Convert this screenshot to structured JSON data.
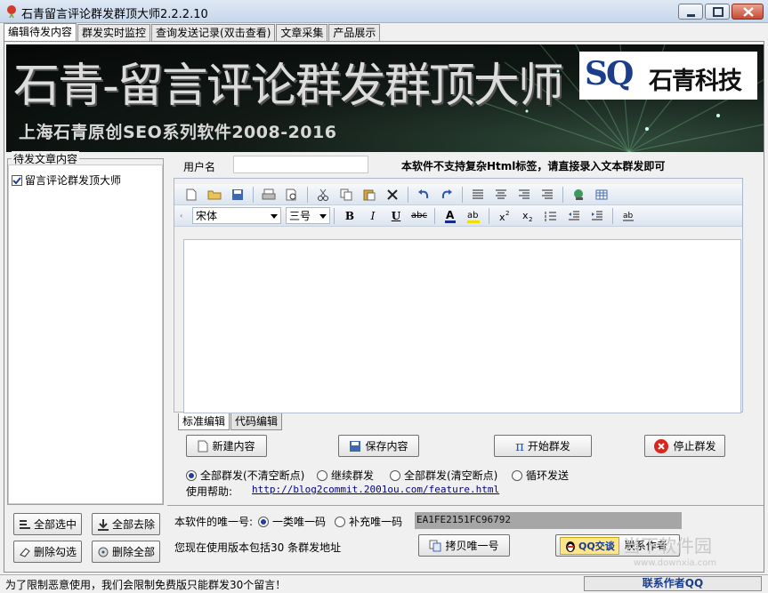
{
  "window": {
    "title": "石青留言评论群发群顶大师2.2.2.10",
    "minimize_icon": "minimize-icon",
    "maximize_icon": "maximize-icon",
    "close_icon": "close-icon"
  },
  "tabs": [
    {
      "label": "编辑待发内容",
      "active": true
    },
    {
      "label": "群发实时监控",
      "active": false
    },
    {
      "label": "查询发送记录(双击查看)",
      "active": false
    },
    {
      "label": "文章采集",
      "active": false
    },
    {
      "label": "产品展示",
      "active": false
    }
  ],
  "banner": {
    "title": "石青-留言评论群发群顶大师",
    "subtitle": "上海石青原创SEO系列软件2008-2016",
    "logo_sq": "SQ",
    "logo_text": "石青科技"
  },
  "left_panel": {
    "legend": "待发文章内容",
    "items": [
      {
        "label": "留言评论群发顶大师",
        "checked": true
      }
    ],
    "buttons": {
      "select_all": "全部选中",
      "deselect_all": "全部去除",
      "delete_checked": "删除勾选",
      "delete_all": "删除全部"
    }
  },
  "form": {
    "username_label": "用户名",
    "username_value": "",
    "html_notice": "本软件不支持复杂Html标签，请直接录入文本群发即可"
  },
  "editor": {
    "font": "宋体",
    "size": "三号",
    "tab_standard": "标准编辑",
    "tab_code": "代码编辑",
    "content": ""
  },
  "actions": {
    "new_content": "新建内容",
    "save_content": "保存内容",
    "start_send": "开始群发",
    "stop_send": "停止群发"
  },
  "send_modes": [
    {
      "label": "全部群发(不清空断点)",
      "selected": true
    },
    {
      "label": "继续群发",
      "selected": false
    },
    {
      "label": "全部群发(清空断点)",
      "selected": false
    },
    {
      "label": "循环发送",
      "selected": false
    }
  ],
  "help": {
    "label": "使用帮助:",
    "link": "http://blog2commit.2001ou.com/feature.html"
  },
  "uid": {
    "label": "本软件的唯一号:",
    "option1": "一类唯一码",
    "option1_selected": true,
    "option2": "补充唯一码",
    "value": "EA1FE2151FC96792",
    "copy_button": "拷贝唯一号"
  },
  "version_text": "您现在使用版本包括30 条群发地址",
  "qq": {
    "button": "QQ交谈",
    "label": "联系作者"
  },
  "status_bar": {
    "text": "为了限制恶意使用，我们会限制免费版只能群发30个留言！",
    "contact": "联系作者QQ"
  },
  "watermark": {
    "text": "当下软件园",
    "url": "www.downxia.com"
  }
}
